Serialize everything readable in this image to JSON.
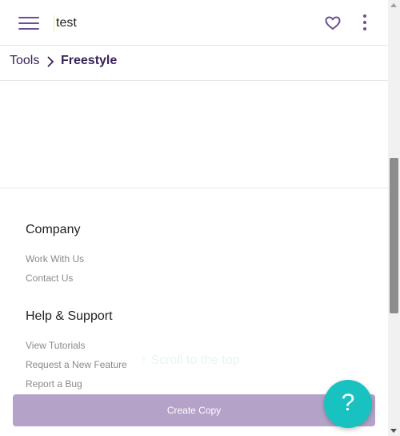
{
  "header": {
    "document_title": "test",
    "menu_icon": "hamburger-menu-icon",
    "favorite_icon": "heart-icon",
    "more_icon": "kebab-menu-icon",
    "accent_color": "#6b4f94"
  },
  "breadcrumb": {
    "parent": "Tools",
    "current": "Freestyle"
  },
  "footer": {
    "company": {
      "title": "Company",
      "links": [
        "Work With Us",
        "Contact Us"
      ]
    },
    "help": {
      "title": "Help & Support",
      "links": [
        "View Tutorials",
        "Request a New Feature",
        "Report a Bug"
      ]
    },
    "scroll_top": "↑ Scroll to the top"
  },
  "actions": {
    "create_copy": "Create Copy",
    "create_copy_color": "#b4a2c8",
    "help": "?",
    "help_color": "#18c2c0"
  }
}
